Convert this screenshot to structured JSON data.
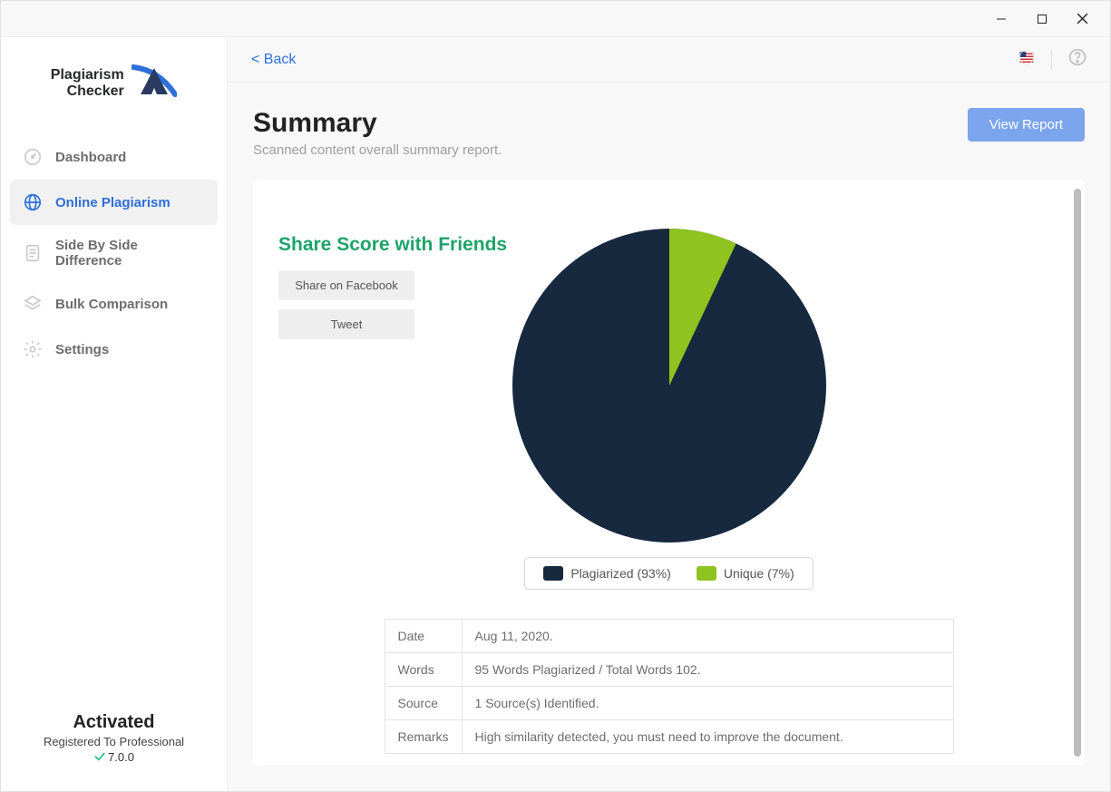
{
  "app": {
    "logo_line1": "Plagiarism",
    "logo_line2": "Checker"
  },
  "sidebar": {
    "items": [
      {
        "label": "Dashboard"
      },
      {
        "label": "Online Plagiarism"
      },
      {
        "label": "Side By Side Difference"
      },
      {
        "label": "Bulk Comparison"
      },
      {
        "label": "Settings"
      }
    ],
    "footer": {
      "activated": "Activated",
      "registered": "Registered To Professional",
      "version": "7.0.0"
    }
  },
  "topbar": {
    "back": "< Back"
  },
  "page": {
    "title": "Summary",
    "subtitle": "Scanned content overall summary report.",
    "view_report": "View Report"
  },
  "share": {
    "title": "Share Score with Friends",
    "facebook": "Share on Facebook",
    "tweet": "Tweet"
  },
  "chart_data": {
    "type": "pie",
    "series": [
      {
        "name": "Plagiarized",
        "value": 93,
        "color": "#17293f"
      },
      {
        "name": "Unique",
        "value": 7,
        "color": "#8fc31f"
      }
    ],
    "legend": [
      {
        "label": "Plagiarized (93%)",
        "color": "#17293f"
      },
      {
        "label": "Unique (7%)",
        "color": "#8fc31f"
      }
    ]
  },
  "table": {
    "rows": [
      {
        "key": "Date",
        "value": "Aug 11, 2020."
      },
      {
        "key": "Words",
        "value": "95 Words Plagiarized / Total Words 102."
      },
      {
        "key": "Source",
        "value": "1 Source(s) Identified."
      },
      {
        "key": "Remarks",
        "value": "High similarity detected, you must need to improve the document."
      }
    ]
  }
}
